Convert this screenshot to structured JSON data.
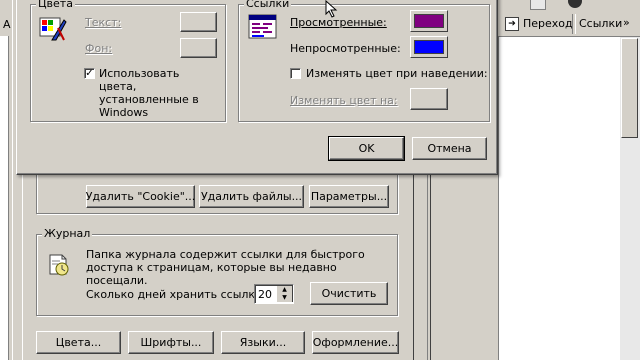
{
  "browser": {
    "toolbar": {
      "go_label": "Переход",
      "links_label": "Ссылки",
      "left_letter": "А"
    }
  },
  "colors_dialog": {
    "colors_group": {
      "title": "Цвета",
      "text_label": "Текст:",
      "background_label": "Фон:",
      "use_windows_colors_label": "Использовать цвета, установленные в Windows",
      "use_windows_colors_checked": true
    },
    "links_group": {
      "title": "Ссылки",
      "visited_label": "Просмотренные:",
      "visited_color": "#800080",
      "unvisited_label": "Непросмотренные:",
      "unvisited_color": "#0000ff",
      "hover_change_label": "Изменять цвет при наведении:",
      "hover_change_checked": false,
      "hover_color_label": "Изменять цвет на:"
    },
    "ok_label": "OK",
    "cancel_label": "Отмена"
  },
  "internet_options": {
    "temp_buttons": {
      "delete_cookies": "Удалить \"Cookie\"...",
      "delete_files": "Удалить файлы...",
      "settings": "Параметры..."
    },
    "history": {
      "title": "Журнал",
      "description": "Папка журнала содержит ссылки для быстрого доступа к страницам, которые вы недавно посещали.",
      "days_label": "Сколько дней хранить ссылки:",
      "days_value": "20",
      "clear_label": "Очистить"
    },
    "bottom_buttons": {
      "colors": "Цвета...",
      "fonts": "Шрифты...",
      "languages": "Языки...",
      "accessibility": "Оформление..."
    }
  }
}
